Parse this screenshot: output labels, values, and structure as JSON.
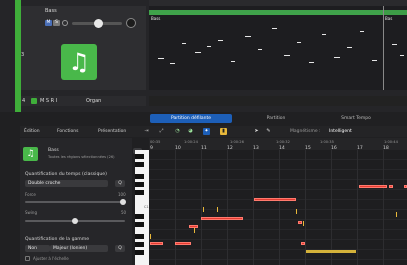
{
  "tracks": {
    "track1": {
      "name": "Bass",
      "number": "3",
      "mute": "M",
      "solo": "S"
    },
    "track2": {
      "number": "4",
      "label": "M S R I",
      "name": "Organ"
    },
    "lane_labels": [
      "Bass",
      "Bas"
    ]
  },
  "editor": {
    "tabs": [
      "Partition défilante",
      "Partition",
      "Smart Tempo"
    ],
    "active_tab": "Partition défilante",
    "toolbar": {
      "edition": "Édition",
      "fonctions": "Fonctions",
      "presentation": "Présentation",
      "magnetisme_label": "Magnétisme :",
      "magnetisme_value": "Intelligent"
    },
    "region": {
      "name": "Bass",
      "desc": "Toutes les régions sélectionnées (26)"
    },
    "quantize": {
      "title": "Quantification du temps (classique)",
      "value": "Double croche",
      "q": "Q",
      "force_label": "Force",
      "force_value": "100",
      "swing_label": "Swing",
      "swing_value": "50"
    },
    "scale": {
      "title": "Quantification de la gamme",
      "key": "Non",
      "mode": "Majeur (Ionien)",
      "q": "Q",
      "adjust": "Ajuster à l'échelle"
    },
    "ruler": {
      "times": [
        "00:35",
        "1:00:24",
        "1:00:26",
        "1:00:32",
        "1:00:35",
        "1:00:44"
      ],
      "bars": [
        "9",
        "10",
        "11",
        "12",
        "13",
        "14",
        "15",
        "16",
        "17",
        "18"
      ]
    },
    "octave_label": "C1"
  },
  "colors": {
    "accent_green": "#49b84a",
    "note_red": "#e43c32",
    "velocity_yellow": "#e8b83a",
    "tab_blue": "#1d5fb8"
  }
}
